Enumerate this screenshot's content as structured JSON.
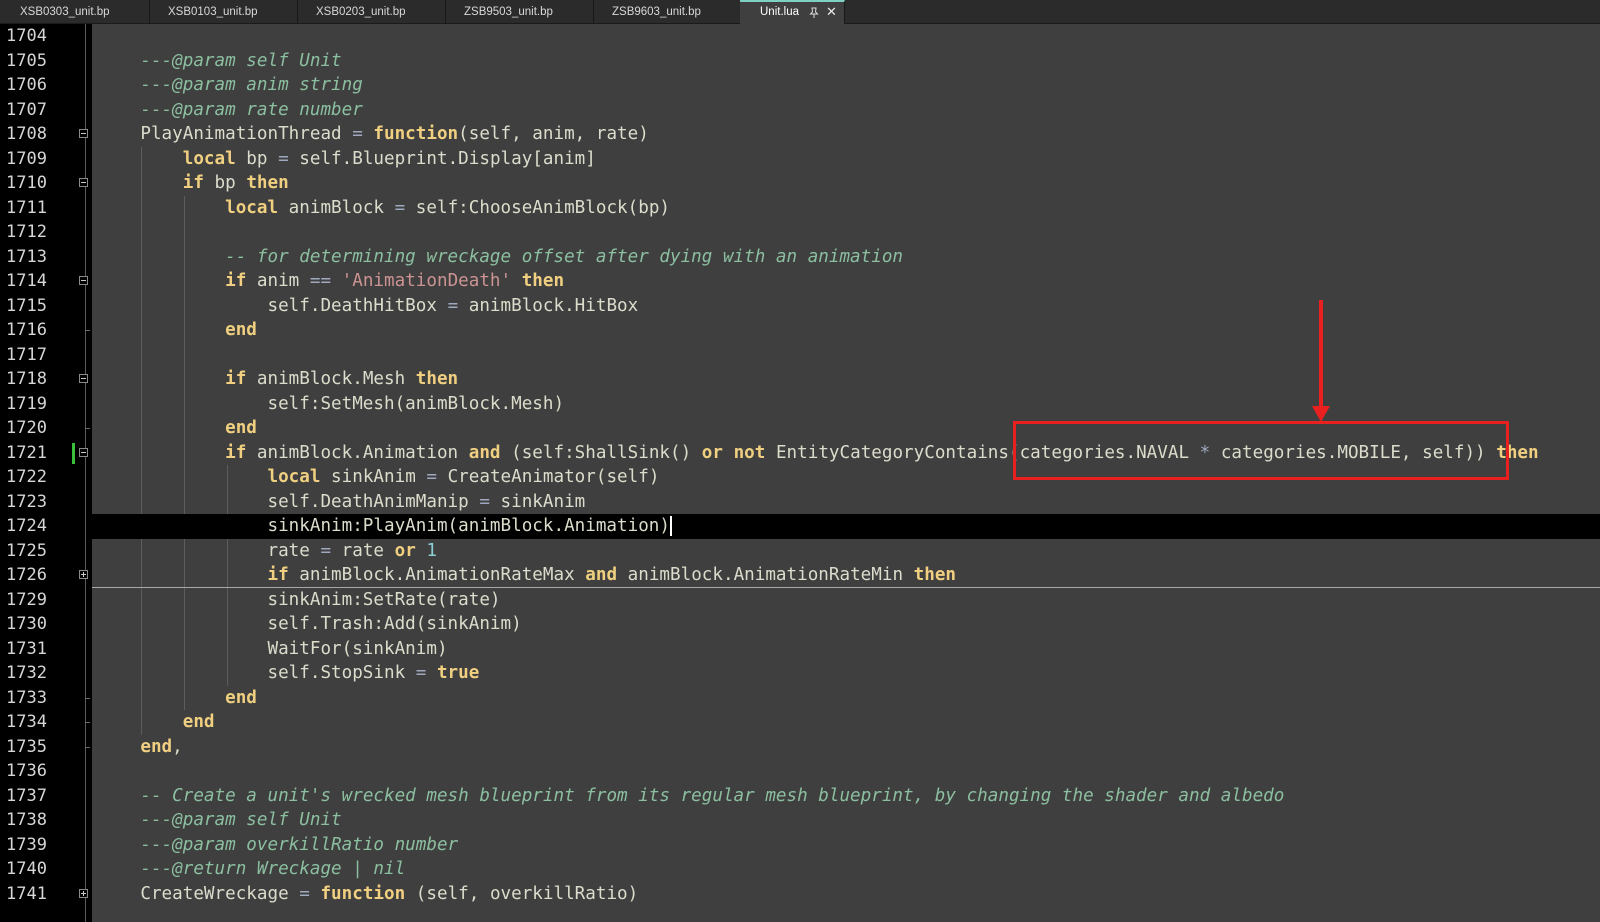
{
  "tabs": [
    {
      "label": "XSB0303_unit.bp",
      "active": false
    },
    {
      "label": "XSB0103_unit.bp",
      "active": false
    },
    {
      "label": "XSB0203_unit.bp",
      "active": false
    },
    {
      "label": "ZSB9503_unit.bp",
      "active": false
    },
    {
      "label": "ZSB9603_unit.bp",
      "active": false
    },
    {
      "label": "Unit.lua",
      "active": true
    }
  ],
  "active_tab_icons": [
    "pin-icon",
    "close-icon"
  ],
  "colors": {
    "background": "#3f3f3f",
    "gutter": "#000000",
    "comment": "#8cbfa0",
    "keyword": "#f0d080",
    "string": "#cc9393",
    "number": "#8cd0d3",
    "annotation": "#e82020",
    "changed_marker": "#3bbf3b"
  },
  "editor": {
    "current_line": "1724",
    "folded_after_line": "1726",
    "highlighted_expression": "(categories.NAVAL * categories.MOBILE, self))",
    "lines": [
      {
        "n": "1704",
        "text": "",
        "fold": ""
      },
      {
        "n": "1705",
        "text": "    ---@param self Unit",
        "fold": ""
      },
      {
        "n": "1706",
        "text": "    ---@param anim string",
        "fold": ""
      },
      {
        "n": "1707",
        "text": "    ---@param rate number",
        "fold": ""
      },
      {
        "n": "1708",
        "text": "    PlayAnimationThread = function(self, anim, rate)",
        "fold": "minus"
      },
      {
        "n": "1709",
        "text": "        local bp = self.Blueprint.Display[anim]",
        "fold": ""
      },
      {
        "n": "1710",
        "text": "        if bp then",
        "fold": "minus"
      },
      {
        "n": "1711",
        "text": "            local animBlock = self:ChooseAnimBlock(bp)",
        "fold": ""
      },
      {
        "n": "1712",
        "text": "",
        "fold": ""
      },
      {
        "n": "1713",
        "text": "            -- for determining wreckage offset after dying with an animation",
        "fold": ""
      },
      {
        "n": "1714",
        "text": "            if anim == 'AnimationDeath' then",
        "fold": "minus"
      },
      {
        "n": "1715",
        "text": "                self.DeathHitBox = animBlock.HitBox",
        "fold": ""
      },
      {
        "n": "1716",
        "text": "            end",
        "fold": "end"
      },
      {
        "n": "1717",
        "text": "",
        "fold": ""
      },
      {
        "n": "1718",
        "text": "            if animBlock.Mesh then",
        "fold": "minus"
      },
      {
        "n": "1719",
        "text": "                self:SetMesh(animBlock.Mesh)",
        "fold": ""
      },
      {
        "n": "1720",
        "text": "            end",
        "fold": "end"
      },
      {
        "n": "1721",
        "text": "            if animBlock.Animation and (self:ShallSink() or not EntityCategoryContains(categories.NAVAL * categories.MOBILE, self)) then",
        "fold": "minus"
      },
      {
        "n": "1722",
        "text": "                local sinkAnim = CreateAnimator(self)",
        "fold": ""
      },
      {
        "n": "1723",
        "text": "                self.DeathAnimManip = sinkAnim",
        "fold": ""
      },
      {
        "n": "1724",
        "text": "                sinkAnim:PlayAnim(animBlock.Animation)",
        "fold": ""
      },
      {
        "n": "1725",
        "text": "                rate = rate or 1",
        "fold": ""
      },
      {
        "n": "1726",
        "text": "                if animBlock.AnimationRateMax and animBlock.AnimationRateMin then",
        "fold": "plus"
      },
      {
        "n": "1729",
        "text": "                sinkAnim:SetRate(rate)",
        "fold": ""
      },
      {
        "n": "1730",
        "text": "                self.Trash:Add(sinkAnim)",
        "fold": ""
      },
      {
        "n": "1731",
        "text": "                WaitFor(sinkAnim)",
        "fold": ""
      },
      {
        "n": "1732",
        "text": "                self.StopSink = true",
        "fold": ""
      },
      {
        "n": "1733",
        "text": "            end",
        "fold": "end"
      },
      {
        "n": "1734",
        "text": "        end",
        "fold": "end"
      },
      {
        "n": "1735",
        "text": "    end,",
        "fold": "end"
      },
      {
        "n": "1736",
        "text": "",
        "fold": ""
      },
      {
        "n": "1737",
        "text": "    -- Create a unit's wrecked mesh blueprint from its regular mesh blueprint, by changing the shader and albedo",
        "fold": ""
      },
      {
        "n": "1738",
        "text": "    ---@param self Unit",
        "fold": ""
      },
      {
        "n": "1739",
        "text": "    ---@param overkillRatio number",
        "fold": ""
      },
      {
        "n": "1740",
        "text": "    ---@return Wreckage | nil",
        "fold": ""
      },
      {
        "n": "1741",
        "text": "    CreateWreckage = function (self, overkillRatio)",
        "fold": "plus"
      }
    ]
  }
}
